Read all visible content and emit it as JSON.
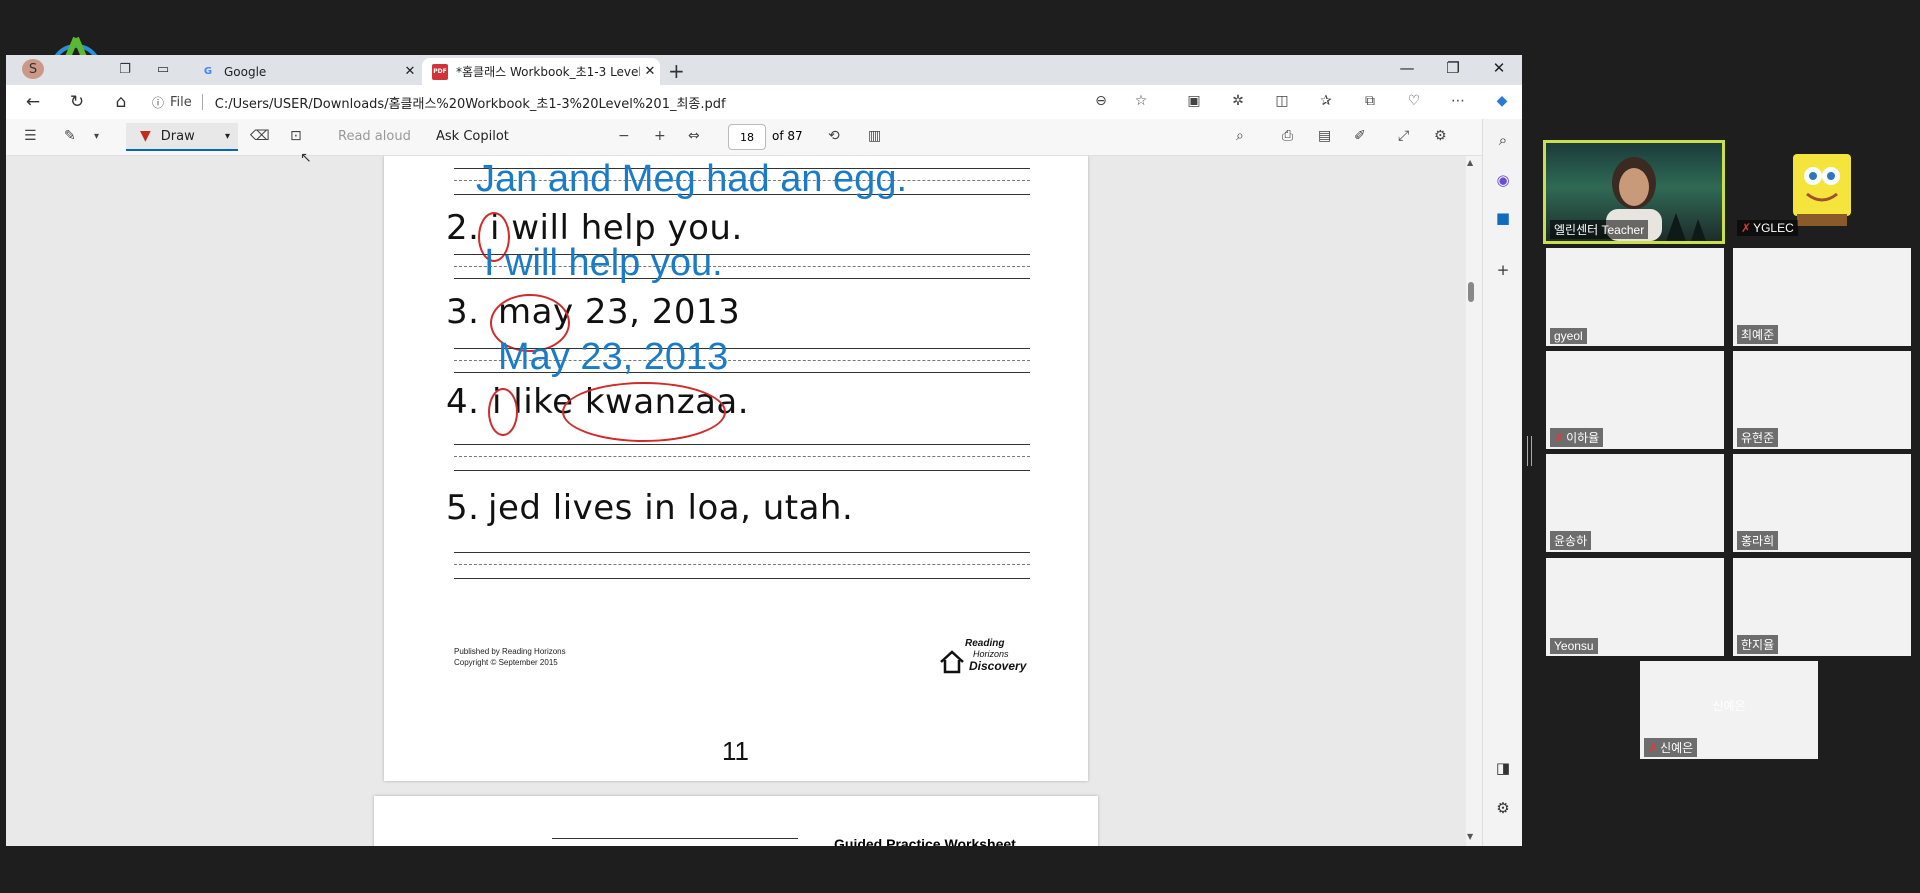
{
  "browser": {
    "tabs": [
      {
        "title": "Google",
        "favicon": "G"
      },
      {
        "title": "*홈클래스 Workbook_초1-3 Level",
        "favicon": "PDF"
      }
    ],
    "profile_label": "S",
    "url_prefix": "File",
    "url": "C:/Users/USER/Downloads/홈클래스%20Workbook_초1-3%20Level%201_최종.pdf"
  },
  "pdf_toolbar": {
    "draw_label": "Draw",
    "read_aloud": "Read aloud",
    "ask_copilot": "Ask Copilot",
    "current_page": "18",
    "page_total": "of 87"
  },
  "worksheet": {
    "line1_typed": "Jan and Meg had an egg.",
    "item2": {
      "num": "2.",
      "text": "i will help you.",
      "typed": "I will help you."
    },
    "item3": {
      "num": "3.",
      "text": "may 23, 2013",
      "typed": "May 23, 2013"
    },
    "item4": {
      "num": "4.",
      "text": "i like kwanzaa."
    },
    "item5": {
      "num": "5.",
      "text": "jed lives in loa, utah."
    },
    "publisher_line1": "Published by Reading Horizons",
    "publisher_line2": "Copyright © September 2015",
    "logo_line1": "Reading",
    "logo_line2": "Horizons",
    "logo_line3": "Discovery",
    "page_number": "11",
    "next_page_heading": "Guided Practice Worksheet"
  },
  "zoom": {
    "participants": [
      {
        "name": "엘린센터 Teacher",
        "muted": false
      },
      {
        "name": "YGLEC",
        "muted": true
      },
      {
        "name": "gyeol",
        "muted": false
      },
      {
        "name": "최예준",
        "muted": false
      },
      {
        "name": "이하율",
        "muted": true
      },
      {
        "name": "유현준",
        "muted": false
      },
      {
        "name": "윤송하",
        "muted": false
      },
      {
        "name": "홍라희",
        "muted": false
      },
      {
        "name": "Yeonsu",
        "muted": false
      },
      {
        "name": "한지율",
        "muted": false
      },
      {
        "name": "신예은",
        "muted": true
      }
    ],
    "tile_placeholder": "신예은"
  },
  "colors": {
    "typed_text": "#1a7bc7",
    "annotation_red": "#d12a2a",
    "accent": "#0067c0",
    "highlight_border": "#c9e04a"
  }
}
